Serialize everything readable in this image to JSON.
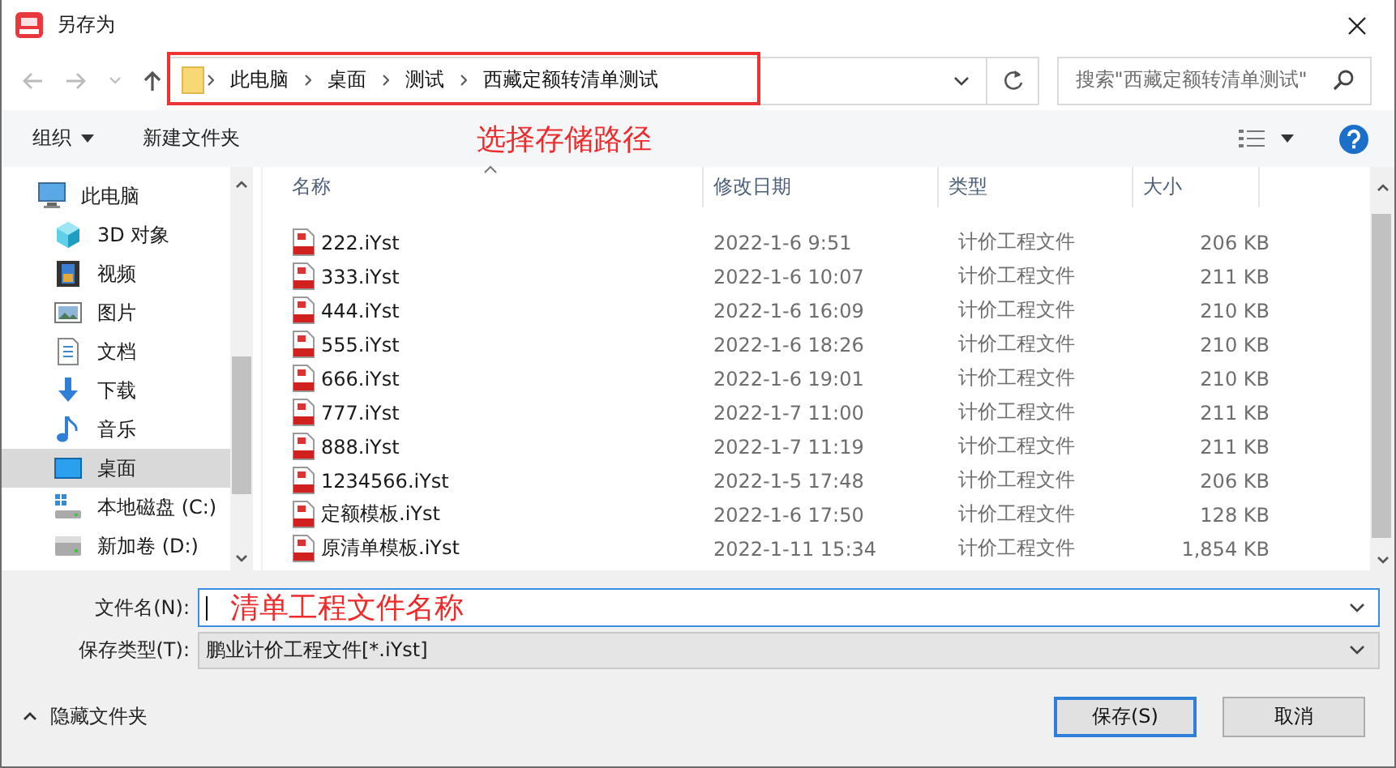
{
  "window": {
    "title": "另存为"
  },
  "address": {
    "crumbs": [
      "此电脑",
      "桌面",
      "测试",
      "西藏定额转清单测试"
    ],
    "annotation": "选择存储路径"
  },
  "search": {
    "placeholder": "搜索\"西藏定额转清单测试\""
  },
  "toolbar": {
    "organize": "组织",
    "new_folder": "新建文件夹"
  },
  "sidebar": {
    "items": [
      {
        "label": "此电脑",
        "kind": "computer",
        "selected": false,
        "children": [
          {
            "label": "3D 对象",
            "kind": "cube",
            "selected": false
          },
          {
            "label": "视频",
            "kind": "video",
            "selected": false
          },
          {
            "label": "图片",
            "kind": "picture",
            "selected": false
          },
          {
            "label": "文档",
            "kind": "document",
            "selected": false
          },
          {
            "label": "下载",
            "kind": "download",
            "selected": false
          },
          {
            "label": "音乐",
            "kind": "music",
            "selected": false
          },
          {
            "label": "桌面",
            "kind": "desktop",
            "selected": true
          },
          {
            "label": "本地磁盘 (C:)",
            "kind": "system_drive",
            "selected": false
          },
          {
            "label": "新加卷 (D:)",
            "kind": "drive",
            "selected": false
          }
        ]
      }
    ]
  },
  "table": {
    "columns": [
      "名称",
      "修改日期",
      "类型",
      "大小"
    ],
    "rows": [
      {
        "name": "222.iYst",
        "date": "2022-1-6 9:51",
        "type": "计价工程文件",
        "size": "206 KB"
      },
      {
        "name": "333.iYst",
        "date": "2022-1-6 10:07",
        "type": "计价工程文件",
        "size": "211 KB"
      },
      {
        "name": "444.iYst",
        "date": "2022-1-6 16:09",
        "type": "计价工程文件",
        "size": "210 KB"
      },
      {
        "name": "555.iYst",
        "date": "2022-1-6 18:26",
        "type": "计价工程文件",
        "size": "210 KB"
      },
      {
        "name": "666.iYst",
        "date": "2022-1-6 19:01",
        "type": "计价工程文件",
        "size": "210 KB"
      },
      {
        "name": "777.iYst",
        "date": "2022-1-7 11:00",
        "type": "计价工程文件",
        "size": "211 KB"
      },
      {
        "name": "888.iYst",
        "date": "2022-1-7 11:19",
        "type": "计价工程文件",
        "size": "211 KB"
      },
      {
        "name": "1234566.iYst",
        "date": "2022-1-5 17:48",
        "type": "计价工程文件",
        "size": "206 KB"
      },
      {
        "name": "定额模板.iYst",
        "date": "2022-1-6 17:50",
        "type": "计价工程文件",
        "size": "128 KB"
      },
      {
        "name": "原清单模板.iYst",
        "date": "2022-1-11 15:34",
        "type": "计价工程文件",
        "size": "1,854 KB"
      }
    ]
  },
  "filename": {
    "label": "文件名(N):",
    "annotation": "清单工程文件名称"
  },
  "filetype": {
    "label": "保存类型(T):",
    "value": "鹏业计价工程文件[*.iYst]"
  },
  "hide_folders": "隐藏文件夹",
  "buttons": [
    {
      "label": "保存(S)",
      "kind": "primary"
    },
    {
      "label": "取消",
      "kind": "default"
    }
  ]
}
